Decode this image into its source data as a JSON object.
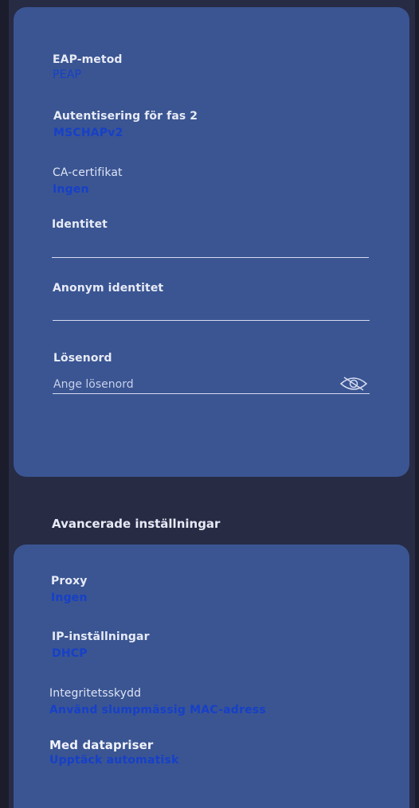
{
  "security": {
    "eap_method": {
      "label": "EAP-metod",
      "value": "PEAP"
    },
    "phase2": {
      "label": "Autentisering för fas 2",
      "value": "MSCHAPv2"
    },
    "ca_cert": {
      "label": "CA-certifikat",
      "value": "Ingen"
    },
    "identity": {
      "label": "Identitet",
      "value": ""
    },
    "anon_identity": {
      "label": "Anonym identitet",
      "value": ""
    },
    "password": {
      "label": "Lösenord",
      "placeholder": "Ange lösenord",
      "toggle_icon": "eye-off-icon"
    }
  },
  "advanced": {
    "title": "Avancerade inställningar",
    "proxy": {
      "label": "Proxy",
      "value": "Ingen"
    },
    "ip": {
      "label": "IP-inställningar",
      "value": "DHCP"
    },
    "privacy": {
      "label": "Integritetsskydd",
      "value": "Använd slumpmässig MAC-adress"
    },
    "metered": {
      "label": "Med datapriser",
      "value": "Upptäck automatisk"
    }
  },
  "colors": {
    "background": "#1b1d2c",
    "panel": "#272b44",
    "card": "#3a5592",
    "value_text": "#1740c8",
    "label_text": "#e7eaf5"
  }
}
